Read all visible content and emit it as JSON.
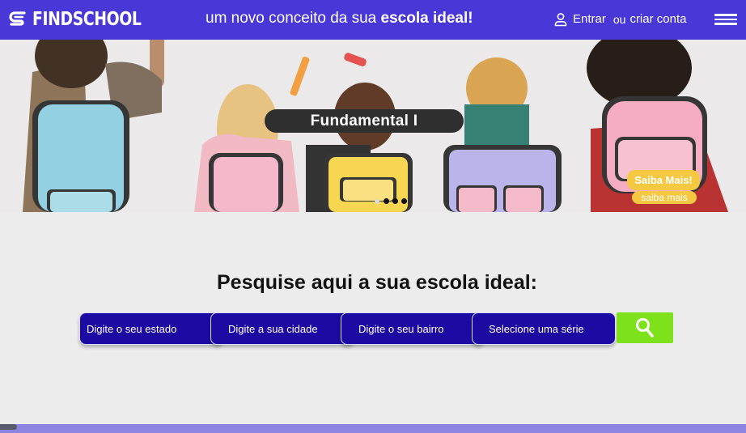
{
  "header": {
    "brand": "FINDSCHOOL",
    "tagline_prefix": "um novo conceito da sua ",
    "tagline_bold": "escola ideal!",
    "login_label": "Entrar",
    "or_label": "ou",
    "signup_label": "criar conta",
    "background_color": "#4a37d8"
  },
  "hero": {
    "banner_label": "Fundamental I",
    "carousel": {
      "total": 4,
      "active": [
        2,
        3,
        4
      ]
    },
    "cta_label": "Saiba Mais!",
    "cta_sub_label": "saiba mais",
    "cta_color": "#f5c842"
  },
  "search": {
    "title": "Pesquise aqui a sua escola ideal:",
    "fields": [
      {
        "placeholder": "Digite o seu estado"
      },
      {
        "placeholder": "Digite a sua cidade"
      },
      {
        "placeholder": "Digite o seu bairro"
      },
      {
        "placeholder": "Selecione uma série"
      }
    ],
    "button_icon": "search-icon",
    "field_color": "#1d0aa3",
    "button_color": "#7ee21a"
  },
  "icons": {
    "logo": "logo-icon",
    "user": "user-icon",
    "menu": "hamburger-menu-icon"
  }
}
